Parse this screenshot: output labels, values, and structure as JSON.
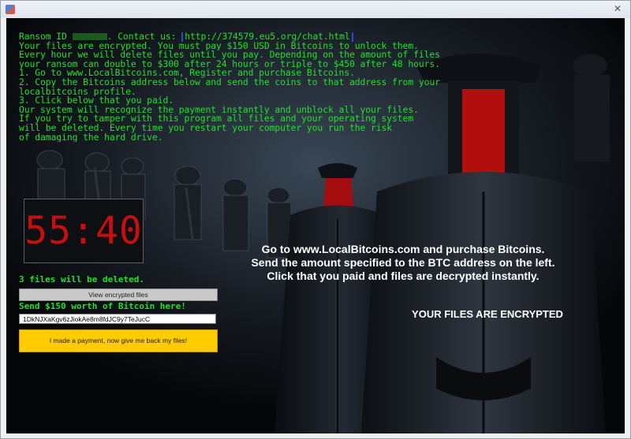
{
  "window": {
    "close_label": "✕"
  },
  "notice": {
    "ransom_id_label": "Ransom ID ",
    "contact_label": ". Contact us: ",
    "contact_url": "http://374579.eu5.org/chat.html",
    "lines": [
      "Your files are encrypted. You must pay $150 USD in Bitcoins to unlock them.",
      "Every hour we will delete files until you pay. Depending on the amount of files",
      "your ransom can double to $300 after 24 hours or triple to $450 after 48 hours.",
      "1. Go to www.LocalBitcoins.com, Register and purchase Bitcoins.",
      "2. Copy the Bitcoins address below and send the coins to that address from your",
      "localbitcoins profile.",
      "3. Click below that you paid.",
      "Our system will recognize the payment instantly and unblock all your files.",
      "If you try to tamper with this program all files and your operating system",
      "will be deleted. Every time you restart your computer you run the risk",
      "of damaging the hard drive.        _"
    ]
  },
  "timer": {
    "value": "55:40"
  },
  "files_deleted": "3 files will be deleted.",
  "view_button": "View encrypted files",
  "send_text": "Send $150 worth of Bitcoin here!",
  "btc_address": "1DkNJXaKgv6zJiokAe8m8fdJC9y7TeJucC",
  "paid_button": "I made a payment, now give me back my files!",
  "instructions": [
    "Go to www.LocalBitcoins.com and purchase Bitcoins.",
    "Send the amount specified to the BTC address on the left.",
    "Click that you paid and files are decrypted instantly."
  ],
  "encrypted_label": "YOUR FILES ARE ENCRYPTED",
  "colors": {
    "terminal_green": "#21e02b",
    "timer_red": "#c80f0f",
    "button_yellow": "#ffcc00",
    "link_border": "#2a48d8"
  }
}
